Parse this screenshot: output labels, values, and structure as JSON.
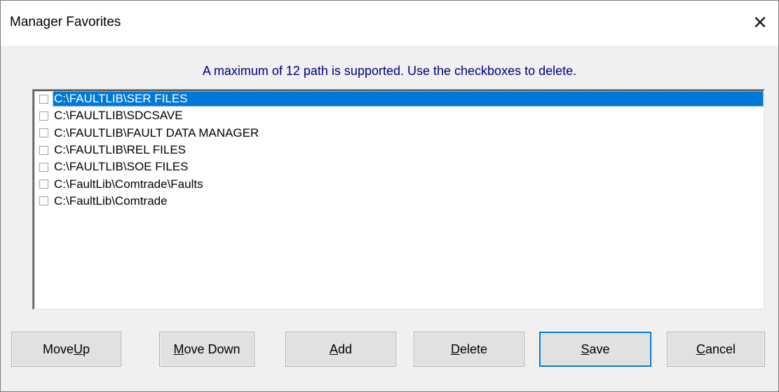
{
  "window": {
    "title": "Manager Favorites",
    "close_glyph": "✕"
  },
  "info_text": "A maximum of 12 path is supported. Use the checkboxes to delete.",
  "paths": [
    {
      "label": "C:\\FAULTLIB\\SER FILES",
      "checked": false,
      "selected": true
    },
    {
      "label": "C:\\FAULTLIB\\SDCSAVE",
      "checked": false,
      "selected": false
    },
    {
      "label": "C:\\FAULTLIB\\FAULT DATA MANAGER",
      "checked": false,
      "selected": false
    },
    {
      "label": "C:\\FAULTLIB\\REL FILES",
      "checked": false,
      "selected": false
    },
    {
      "label": "C:\\FAULTLIB\\SOE FILES",
      "checked": false,
      "selected": false
    },
    {
      "label": "C:\\FaultLib\\Comtrade\\Faults",
      "checked": false,
      "selected": false
    },
    {
      "label": "C:\\FaultLib\\Comtrade",
      "checked": false,
      "selected": false
    }
  ],
  "buttons": {
    "move_up": {
      "pre": "Move ",
      "key": "U",
      "post": "p"
    },
    "move_down": {
      "pre": "",
      "key": "M",
      "post": "ove Down"
    },
    "add": {
      "pre": "",
      "key": "A",
      "post": "dd"
    },
    "delete": {
      "pre": "",
      "key": "D",
      "post": "elete"
    },
    "save": {
      "pre": "",
      "key": "S",
      "post": "ave"
    },
    "cancel": {
      "pre": "",
      "key": "C",
      "post": "ancel"
    }
  },
  "colors": {
    "selection": "#0078d7",
    "info_text": "#000080"
  }
}
